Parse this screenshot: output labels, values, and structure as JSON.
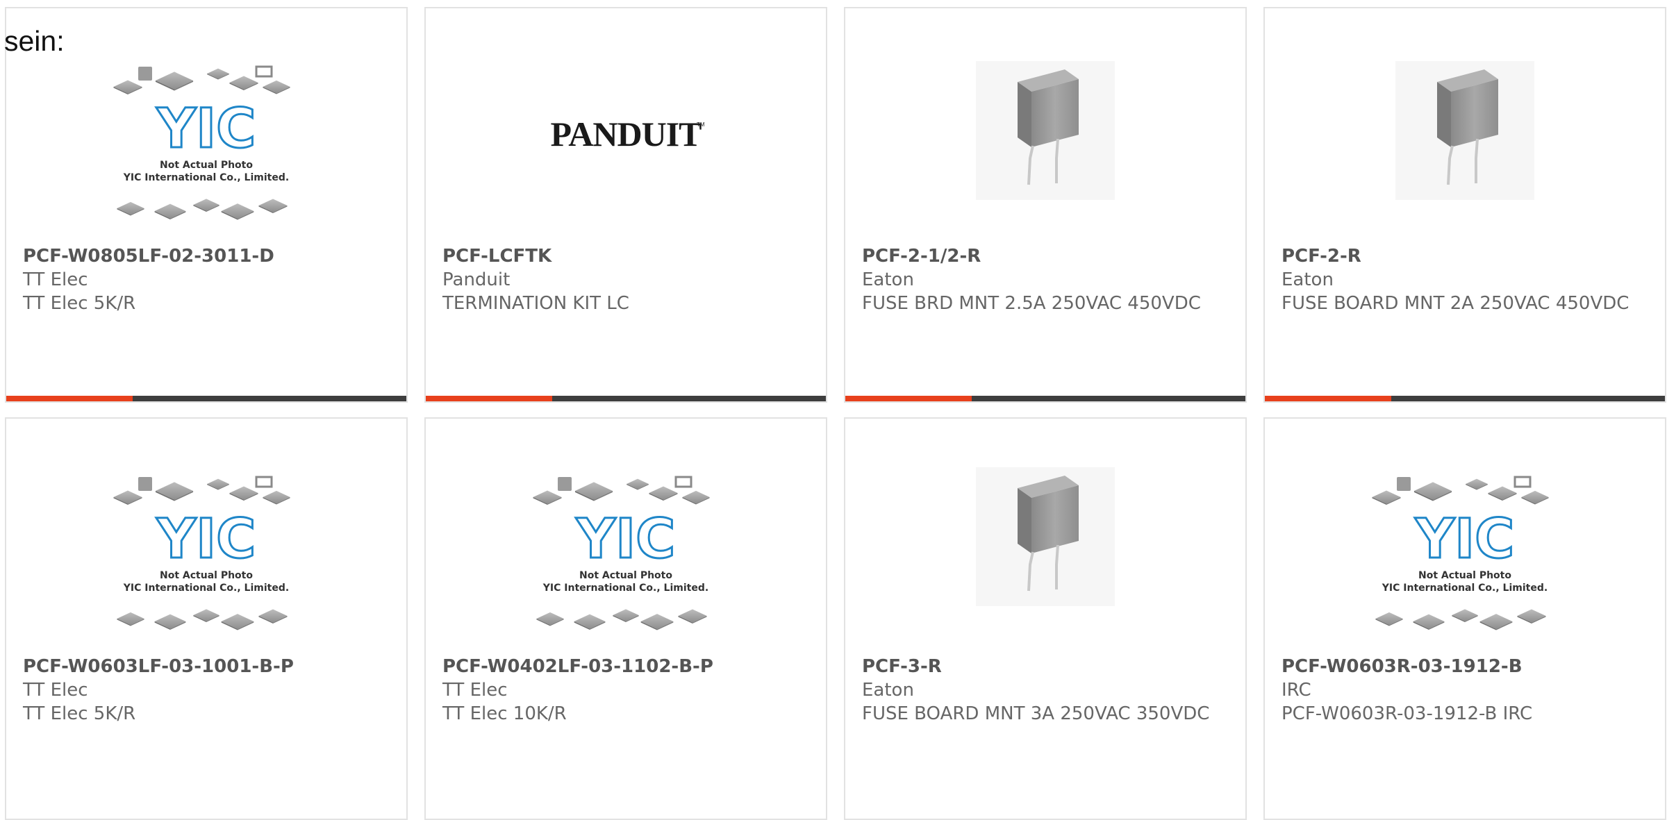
{
  "intro_text": "sein:",
  "accent_color": "#e8401c",
  "bar_color": "#3e3e3e",
  "placeholder": {
    "line1": "Not Actual Photo",
    "line2": "YIC International Co., Limited.",
    "logo_text": "YIC"
  },
  "panduit_logo": "PANDUIT",
  "products": [
    {
      "part_number": "PCF-W0805LF-02-3011-D",
      "manufacturer": "TT Elec",
      "description": "TT Elec 5K/R",
      "image": "yic-placeholder"
    },
    {
      "part_number": "PCF-LCFTK",
      "manufacturer": "Panduit",
      "description": "TERMINATION KIT LC",
      "image": "panduit-logo"
    },
    {
      "part_number": "PCF-2-1/2-R",
      "manufacturer": "Eaton",
      "description": "FUSE BRD MNT 2.5A 250VAC 450VDC",
      "image": "fuse-component"
    },
    {
      "part_number": "PCF-2-R",
      "manufacturer": "Eaton",
      "description": "FUSE BOARD MNT 2A 250VAC 450VDC",
      "image": "fuse-component"
    },
    {
      "part_number": "PCF-W0603LF-03-1001-B-P",
      "manufacturer": "TT Elec",
      "description": "TT Elec 5K/R",
      "image": "yic-placeholder"
    },
    {
      "part_number": "PCF-W0402LF-03-1102-B-P",
      "manufacturer": "TT Elec",
      "description": "TT Elec 10K/R",
      "image": "yic-placeholder"
    },
    {
      "part_number": "PCF-3-R",
      "manufacturer": "Eaton",
      "description": "FUSE BOARD MNT 3A 250VAC 350VDC",
      "image": "fuse-component"
    },
    {
      "part_number": "PCF-W0603R-03-1912-B",
      "manufacturer": "IRC",
      "description": "PCF-W0603R-03-1912-B IRC",
      "image": "yic-placeholder"
    }
  ]
}
